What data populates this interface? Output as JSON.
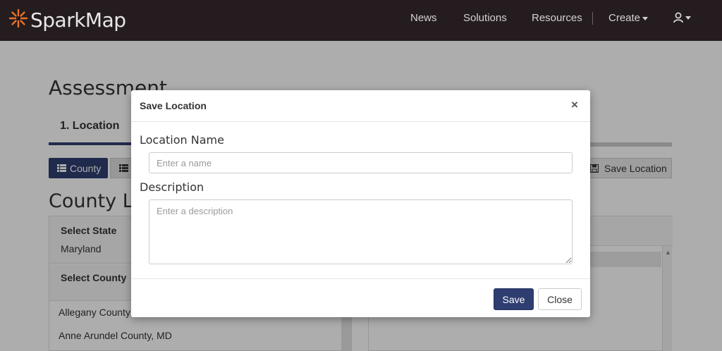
{
  "navbar": {
    "brand": "SparkMap",
    "items": [
      "News",
      "Solutions",
      "Resources"
    ],
    "create": "Create"
  },
  "page": {
    "title": "Assessment",
    "tab_location": "1. Location",
    "county_button": "County",
    "save_location_button": "Save Location",
    "county_heading": "County Li",
    "select_state_label": "Select State",
    "state_value": "Maryland",
    "select_county_label": "Select County",
    "counties": [
      "Allegany County",
      "Anne Arundel County, MD"
    ]
  },
  "modal": {
    "title": "Save Location",
    "close_symbol": "×",
    "name_label": "Location Name",
    "name_placeholder": "Enter a name",
    "description_label": "Description",
    "description_placeholder": "Enter a description",
    "save_label": "Save",
    "close_label": "Close"
  },
  "colors": {
    "navbar_bg": "#241c1e",
    "primary": "#2e3e70",
    "brand_star": "#e8722a"
  }
}
